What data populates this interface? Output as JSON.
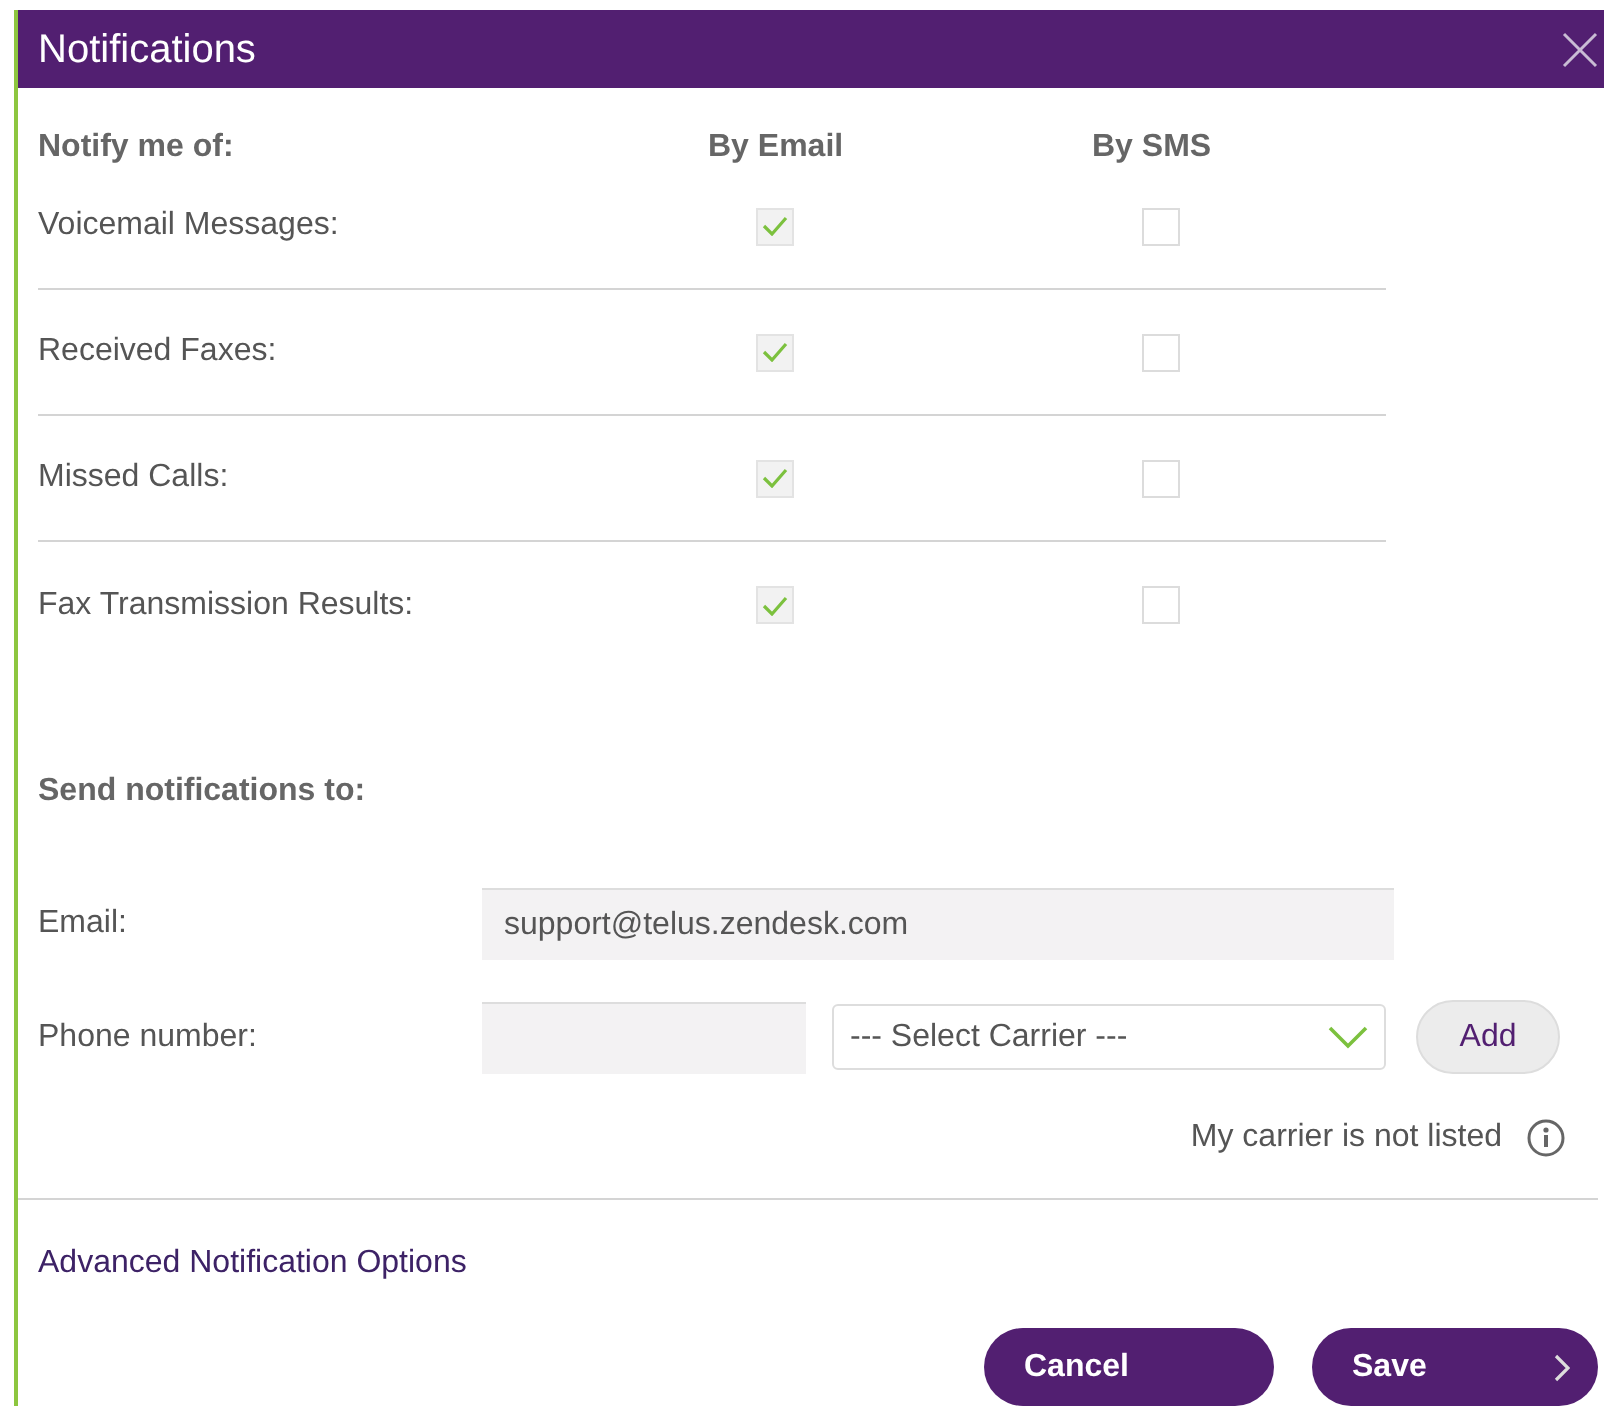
{
  "window": {
    "title": "Notifications"
  },
  "columns": [
    "Notify me of:",
    "By Email",
    "By SMS"
  ],
  "rows": [
    {
      "label": "Voicemail Messages:",
      "email": true,
      "sms": false
    },
    {
      "label": "Received Faxes:",
      "email": true,
      "sms": false
    },
    {
      "label": "Missed Calls:",
      "email": true,
      "sms": false
    },
    {
      "label": "Fax Transmission Results:",
      "email": true,
      "sms": false
    }
  ],
  "send_to": {
    "heading": "Send notifications to:",
    "email_label": "Email:",
    "email_value": "support@telus.zendesk.com",
    "phone_label": "Phone number:",
    "carrier_select": "--- Select Carrier ---",
    "add_button": "Add",
    "carrier_note": "My carrier is not listed"
  },
  "advanced_link": "Advanced Notification Options",
  "buttons": [
    "Cancel",
    "Save"
  ]
}
